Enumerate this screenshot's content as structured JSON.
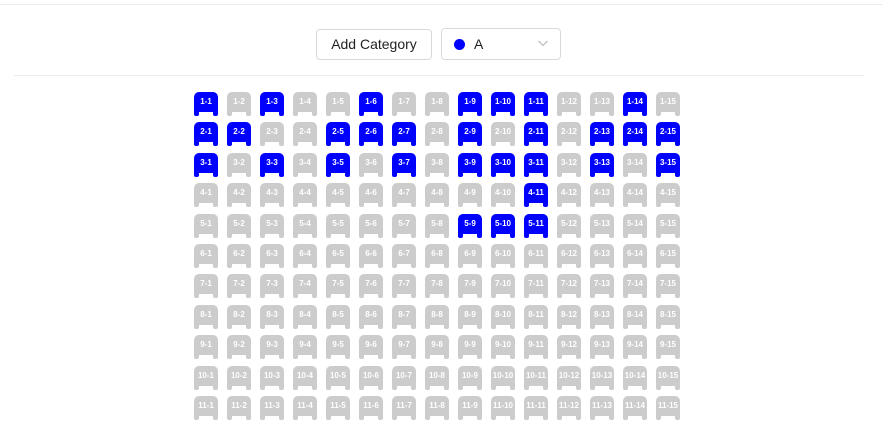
{
  "toolbar": {
    "add_category_label": "Add Category",
    "category_select": {
      "selected_label": "A",
      "selected_color": "#0000ff"
    }
  },
  "seat_map": {
    "rows": 11,
    "columns": 15,
    "available_color": "#cccccc",
    "category_color": "#0000ff",
    "category_a_seats": [
      "1-1",
      "1-3",
      "1-6",
      "1-9",
      "1-10",
      "1-11",
      "1-14",
      "2-1",
      "2-2",
      "2-5",
      "2-6",
      "2-7",
      "2-9",
      "2-11",
      "2-13",
      "2-14",
      "2-15",
      "3-1",
      "3-3",
      "3-5",
      "3-7",
      "3-9",
      "3-10",
      "3-11",
      "3-13",
      "3-15",
      "4-11",
      "5-9",
      "5-10",
      "5-11"
    ]
  }
}
